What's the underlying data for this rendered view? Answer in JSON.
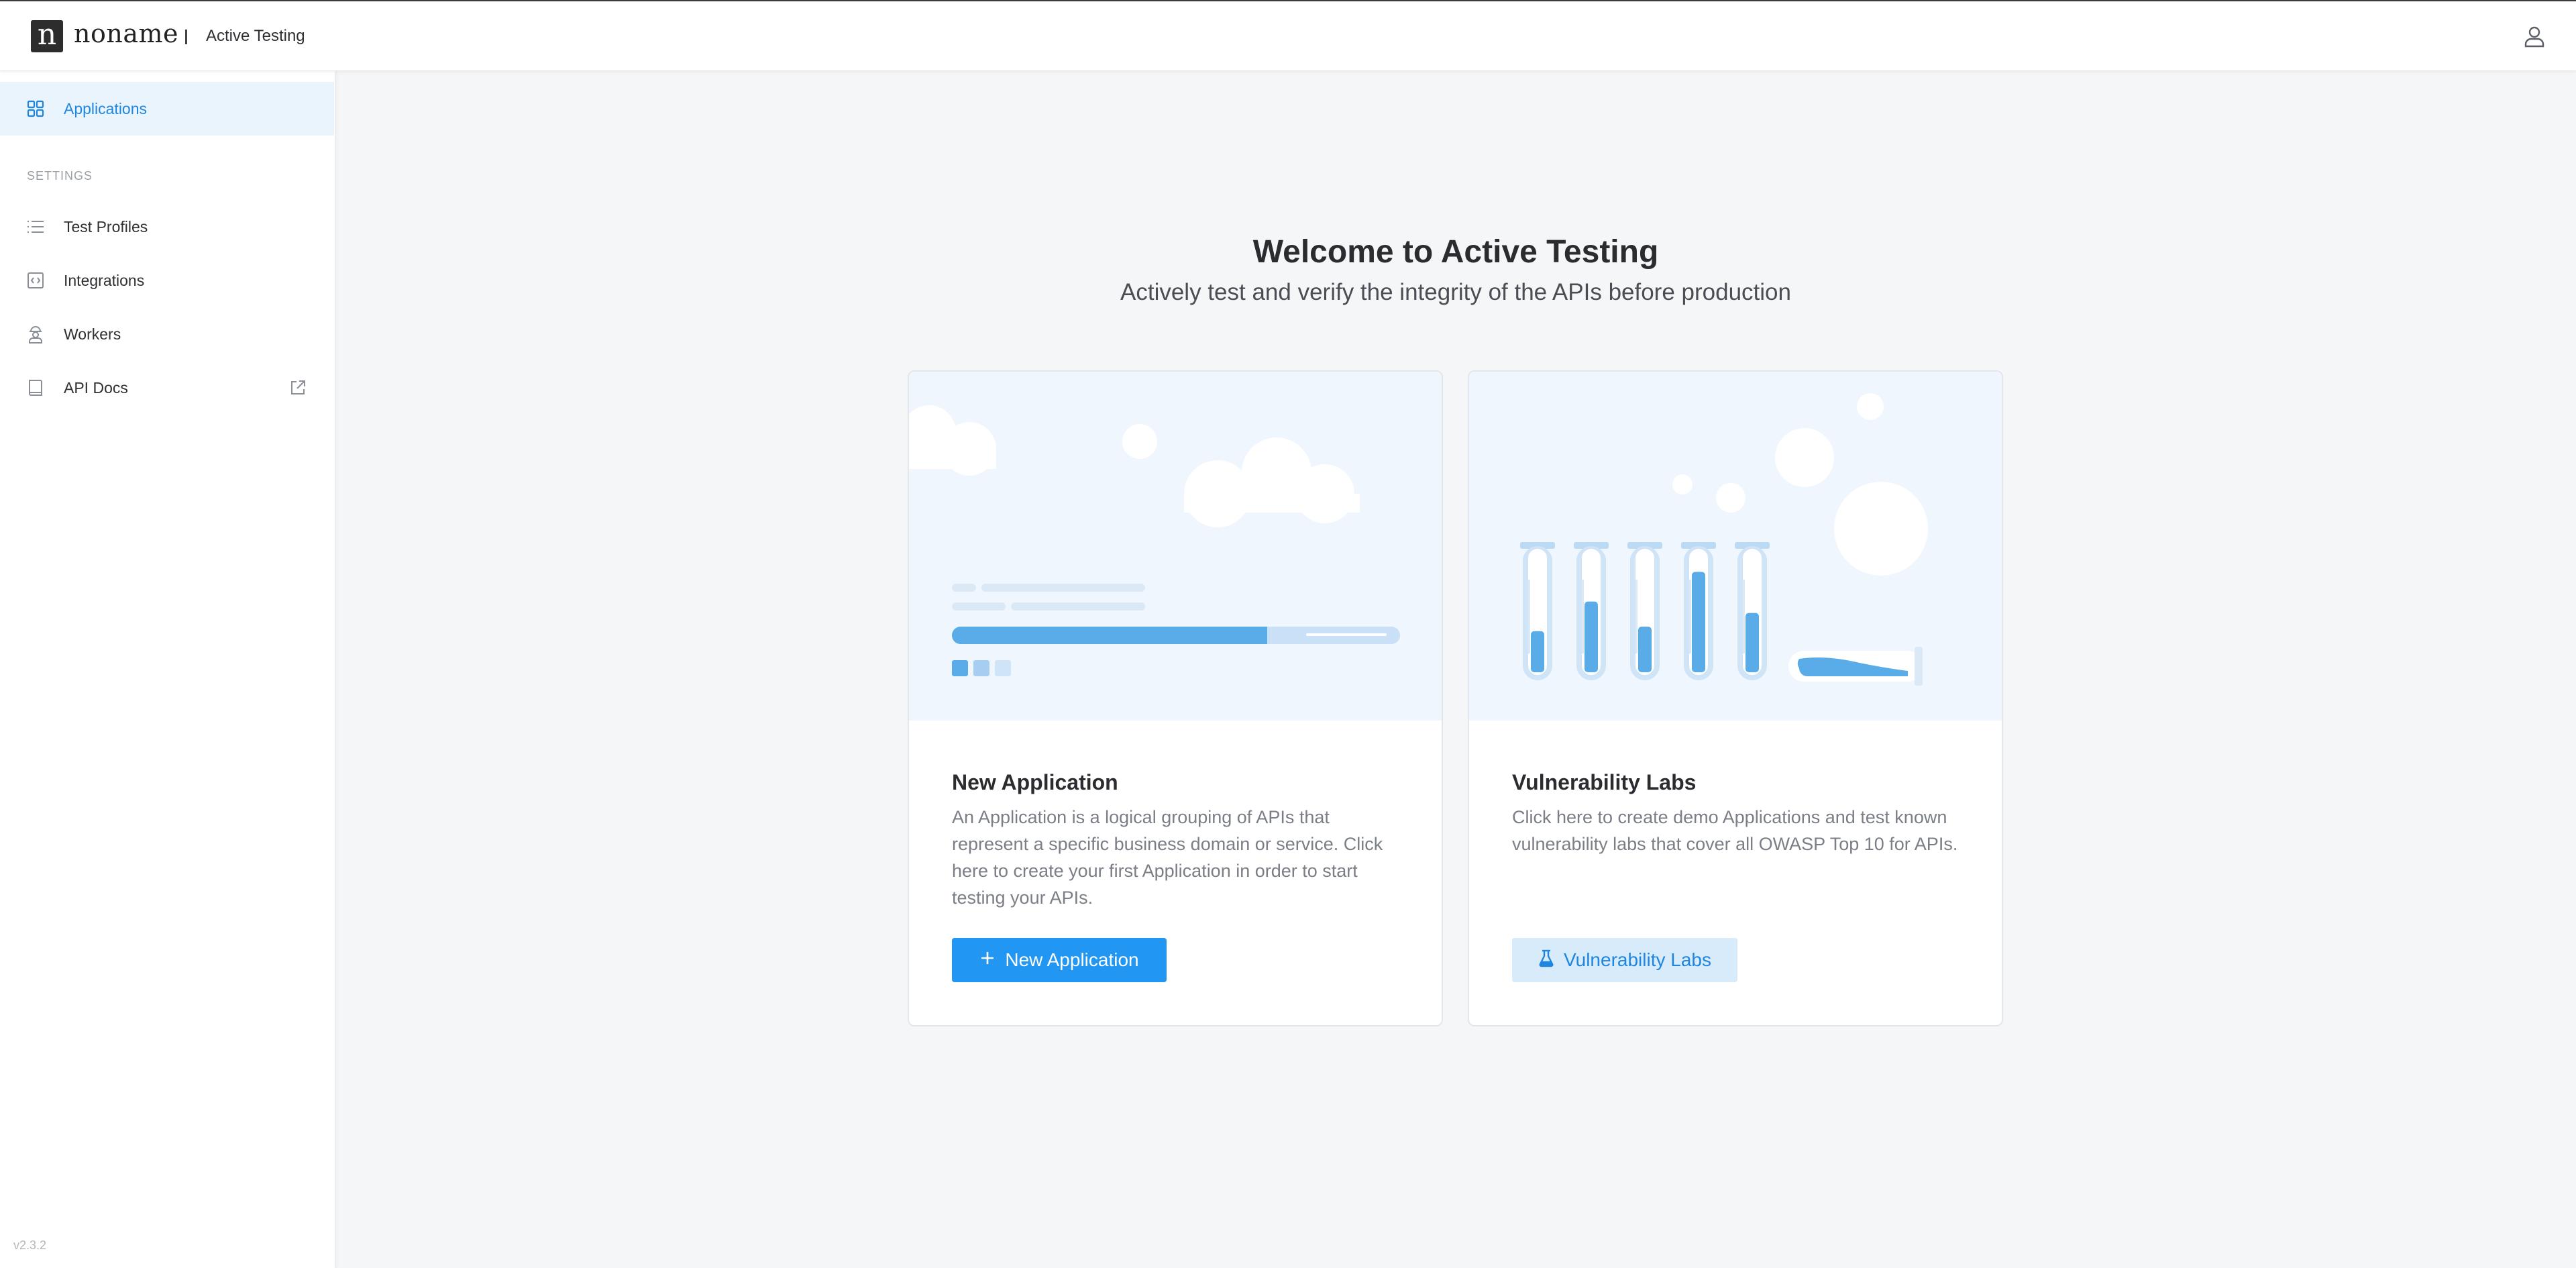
{
  "header": {
    "logo_letter": "n",
    "logo_text": "noname",
    "product_name": "Active Testing"
  },
  "sidebar": {
    "items": [
      {
        "label": "Applications",
        "icon": "grid-icon",
        "active": true
      }
    ],
    "section_label": "SETTINGS",
    "settings_items": [
      {
        "label": "Test Profiles",
        "icon": "list-icon"
      },
      {
        "label": "Integrations",
        "icon": "code-box-icon"
      },
      {
        "label": "Workers",
        "icon": "worker-icon"
      },
      {
        "label": "API Docs",
        "icon": "book-icon",
        "trailing_icon": "external-link-icon"
      }
    ],
    "version": "v2.3.2"
  },
  "main": {
    "title": "Welcome to Active Testing",
    "subtitle": "Actively test and verify the integrity of the APIs before production",
    "cards": [
      {
        "title": "New Application",
        "description": "An Application is a logical grouping of APIs that represent a specific business domain or service. Click here to create your first Application in order to start testing your APIs.",
        "button_label": "New Application",
        "button_icon": "plus-icon"
      },
      {
        "title": "Vulnerability Labs",
        "description": "Click here to create demo Applications and test known vulnerability labs that cover all OWASP Top 10 for APIs.",
        "button_label": "Vulnerability Labs",
        "button_icon": "flask-icon"
      }
    ]
  },
  "colors": {
    "accent": "#2196f3",
    "accent_text": "#1f86e0",
    "active_bg": "#eaf4fd",
    "illustration_bg": "#eff6fd"
  }
}
